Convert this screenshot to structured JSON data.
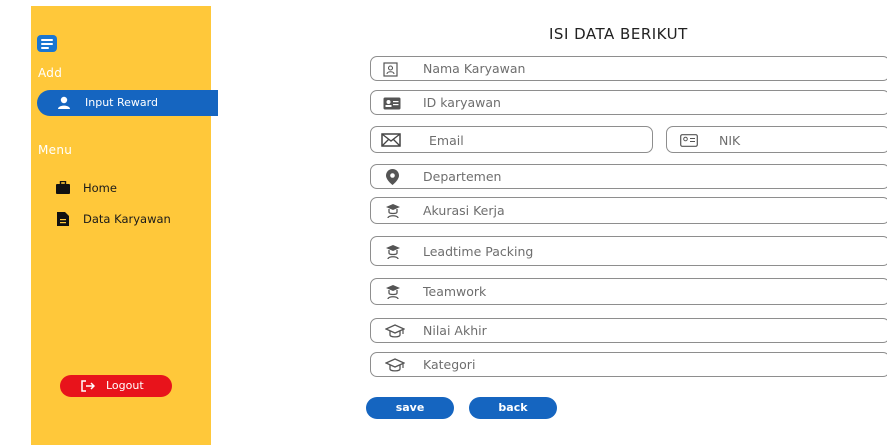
{
  "sidebar": {
    "add_section": "Add",
    "menu_section": "Menu",
    "active_item": {
      "label": "Input Reward",
      "icon": "user-icon"
    },
    "nav_items": [
      {
        "label": "Home",
        "icon": "briefcase-icon"
      },
      {
        "label": "Data Karyawan",
        "icon": "document-icon"
      }
    ],
    "logout": {
      "label": "Logout",
      "icon": "logout-icon"
    }
  },
  "form": {
    "title": "ISI DATA BERIKUT",
    "fields": [
      {
        "placeholder": "Nama Karyawan",
        "icon": "id-card-icon"
      },
      {
        "placeholder": "ID karyawan",
        "icon": "id-badge-icon"
      },
      {
        "placeholder": "Email",
        "icon": "envelope-icon"
      },
      {
        "placeholder": "NIK",
        "icon": "id-badge-icon"
      },
      {
        "placeholder": "Departemen",
        "icon": "location-pin-icon"
      },
      {
        "placeholder": "Akurasi Kerja",
        "icon": "graduate-icon"
      },
      {
        "placeholder": "Leadtime Packing",
        "icon": "graduate-icon"
      },
      {
        "placeholder": "Teamwork",
        "icon": "graduate-icon"
      },
      {
        "placeholder": "Nilai Akhir",
        "icon": "graduation-cap-icon"
      },
      {
        "placeholder": "Kategori",
        "icon": "graduation-cap-icon"
      }
    ],
    "save_label": "save",
    "back_label": "back"
  },
  "colors": {
    "sidebar": "#FFC83A",
    "primary": "#1565C0",
    "logout": "#E8131B"
  }
}
